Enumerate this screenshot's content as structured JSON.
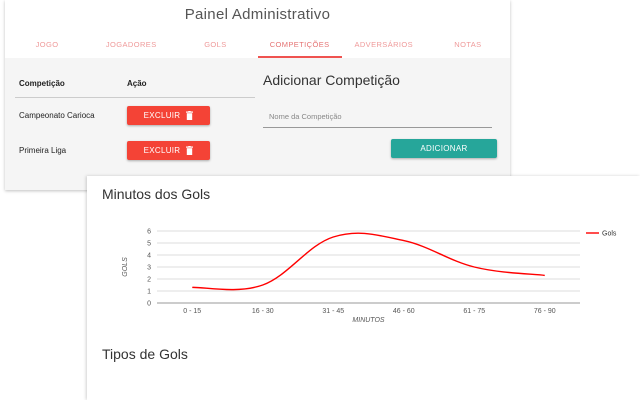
{
  "header": {
    "title": "Painel Administrativo"
  },
  "tabs": [
    {
      "label": "JOGO"
    },
    {
      "label": "JOGADORES"
    },
    {
      "label": "GOLS"
    },
    {
      "label": "COMPETIÇÕES",
      "active": true
    },
    {
      "label": "ADVERSÁRIOS"
    },
    {
      "label": "NOTAS"
    }
  ],
  "competitions_table": {
    "headers": {
      "competicao": "Competição",
      "acao": "Ação"
    },
    "rows": [
      {
        "name": "Campeonato Carioca",
        "action_label": "EXCLUIR"
      },
      {
        "name": "Primeira Liga",
        "action_label": "EXCLUIR"
      }
    ]
  },
  "add_form": {
    "title": "Adicionar Competição",
    "placeholder": "Nome da Competição",
    "value": "",
    "button_label": "ADICIONAR"
  },
  "colors": {
    "danger": "#f44336",
    "primary": "#26a69a",
    "accent": "#ef5350",
    "line": "#ff0000"
  },
  "chart_data": {
    "type": "line",
    "title": "Minutos dos Gols",
    "xlabel": "MINUTOS",
    "ylabel": "GOLS",
    "categories": [
      "0 - 15",
      "16 - 30",
      "31 - 45",
      "46 - 60",
      "61 - 75",
      "76 - 90"
    ],
    "series": [
      {
        "name": "Gols",
        "values": [
          1.3,
          1.5,
          5.5,
          5.2,
          3.0,
          2.3
        ]
      }
    ],
    "yticks": [
      0,
      1,
      2,
      3,
      4,
      5,
      6
    ],
    "ylim": [
      0,
      6
    ],
    "grid": true,
    "legend": "right"
  },
  "second_chart": {
    "title": "Tipos de Gols"
  }
}
